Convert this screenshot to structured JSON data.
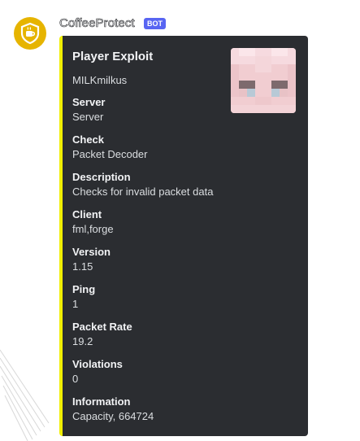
{
  "message": {
    "username": "CoffeeProtect",
    "bot_tag": "BOT",
    "avatar_icon": "coffee-shield-icon"
  },
  "embed": {
    "accent_color": "#f0ef00",
    "title": "Player Exploit",
    "description": "MILKmilkus",
    "thumbnail": "player-skin-face",
    "fields": [
      {
        "name": "Server",
        "value": "Server"
      },
      {
        "name": "Check",
        "value": "Packet Decoder"
      },
      {
        "name": "Description",
        "value": "Checks for invalid packet data"
      },
      {
        "name": "Client",
        "value": "fml,forge"
      },
      {
        "name": "Version",
        "value": "1.15"
      },
      {
        "name": "Ping",
        "value": "1"
      },
      {
        "name": "Packet Rate",
        "value": "19.2"
      },
      {
        "name": "Violations",
        "value": "0"
      },
      {
        "name": "Information",
        "value": "Capacity, 664724"
      }
    ]
  }
}
